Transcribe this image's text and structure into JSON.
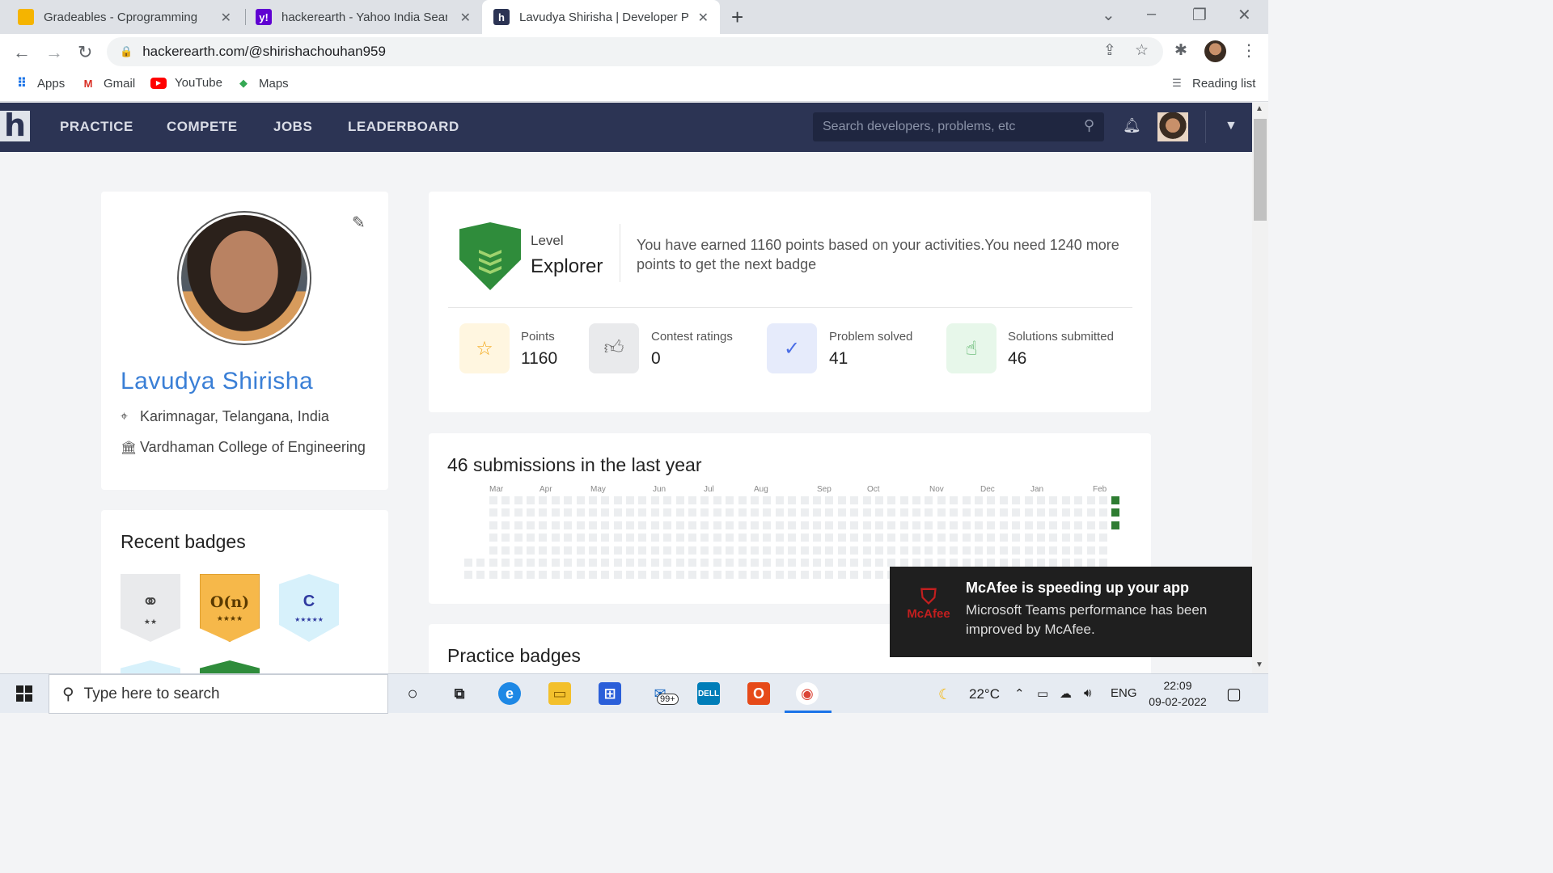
{
  "browser": {
    "tabs": [
      {
        "title": "Gradeables - Cprogramming",
        "close": "✕"
      },
      {
        "title": "hackerearth - Yahoo India Search",
        "close": "✕"
      },
      {
        "title": "Lavudya Shirisha | Developer Profile",
        "close": "✕"
      }
    ],
    "new_tab": "+",
    "url": "hackerearth.com/@shirishachouhan959",
    "bookmarks": [
      "Apps",
      "Gmail",
      "YouTube",
      "Maps"
    ],
    "reading_list": "Reading list"
  },
  "site": {
    "logo": "h",
    "nav": [
      "PRACTICE",
      "COMPETE",
      "JOBS",
      "LEADERBOARD"
    ],
    "search_placeholder": "Search developers, problems, etc"
  },
  "profile": {
    "name": "Lavudya Shirisha",
    "location": "Karimnagar, Telangana, India",
    "college": "Vardhaman College of Engineering"
  },
  "recent_badges": {
    "title": "Recent badges",
    "items": [
      {
        "icon": "tree-icon",
        "text": "",
        "stars": "★★",
        "color": "#e9eaec"
      },
      {
        "icon": "complexity-icon",
        "text": "O(n)",
        "stars": "★★★★",
        "color": "#f6b84a"
      },
      {
        "icon": "c-icon",
        "text": "C",
        "stars": "★★★★★",
        "color": "#d7f1fb"
      }
    ]
  },
  "level": {
    "label": "Level",
    "value": "Explorer",
    "message": "You have earned 1160 points based on your activities.You need 1240 more points to get the next badge"
  },
  "stats": [
    {
      "label": "Points",
      "value": "1160",
      "icon": "star-icon",
      "color": "#fff6e0"
    },
    {
      "label": "Contest ratings",
      "value": "0",
      "icon": "thumbs-up-icon",
      "color": "#e9eaec"
    },
    {
      "label": "Problem solved",
      "value": "41",
      "icon": "check-circle-icon",
      "color": "#e6ebfb"
    },
    {
      "label": "Solutions submitted",
      "value": "46",
      "icon": "pointer-hand-icon",
      "color": "#e7f7ea"
    }
  ],
  "submissions": {
    "title": "46 submissions in the last year",
    "months": [
      "Mar",
      "Apr",
      "May",
      "Jun",
      "Jul",
      "Aug",
      "Sep",
      "Oct",
      "Nov",
      "Dec",
      "Jan",
      "Feb"
    ],
    "active_color": "#2e7d32"
  },
  "practice_badges": {
    "title": "Practice badges"
  },
  "toast": {
    "brand": "McAfee",
    "title": "McAfee is speeding up your app",
    "body": "Microsoft Teams performance has been improved by McAfee."
  },
  "taskbar": {
    "search_placeholder": "Type here to search",
    "mail_badge": "99+",
    "temperature": "22°C",
    "language": "ENG",
    "time": "22:09",
    "date": "09-02-2022"
  }
}
